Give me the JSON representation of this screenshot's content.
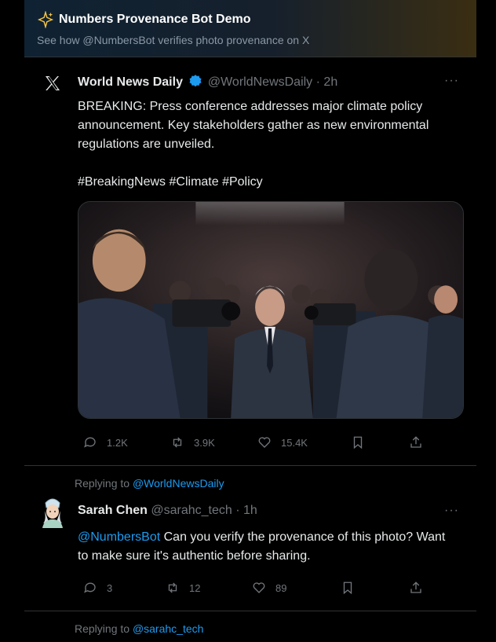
{
  "banner": {
    "title": "Numbers Provenance Bot Demo",
    "subtitle": "See how @NumbersBot verifies photo provenance on X",
    "icon": "sparkle-icon"
  },
  "post": {
    "author_name": "World News Daily",
    "handle": "@WorldNewsDaily",
    "time": "· 2h",
    "text_line1": "BREAKING: Press conference addresses major climate policy",
    "text_line2": "announcement. Key stakeholders gather as new environmental",
    "text_line3": "regulations are unveiled.",
    "hashtags": "#BreakingNews #Climate #Policy",
    "verified_color": "#1d9bf0",
    "replies": "1.2K",
    "reposts": "3.9K",
    "likes": "15.4K",
    "more": "···"
  },
  "reply1": {
    "replying_prefix": "Replying to",
    "replying_handle": "@WorldNewsDaily",
    "author_name": "Sarah Chen",
    "handle": "@sarahc_tech",
    "time": "· 1h",
    "mention": "@NumbersBot",
    "text_rest": " Can you verify the provenance of this photo? Want",
    "text_line2": "to make sure it's authentic before sharing.",
    "replies": "3",
    "reposts": "12",
    "likes": "89",
    "more": "···"
  },
  "reply2": {
    "replying_prefix": "Replying to",
    "replying_handle": "@sarahc_tech"
  }
}
